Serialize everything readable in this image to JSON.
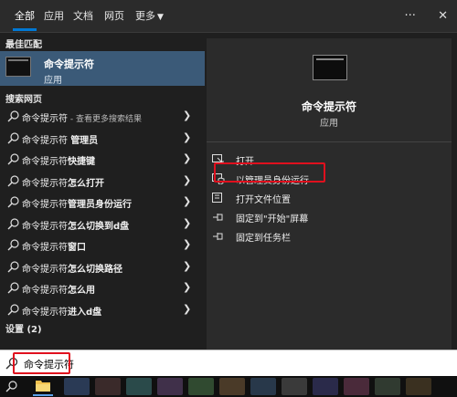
{
  "tabs": [
    {
      "label": "全部",
      "active": true
    },
    {
      "label": "应用"
    },
    {
      "label": "文档"
    },
    {
      "label": "网页"
    },
    {
      "label": "更多"
    }
  ],
  "top_icons": [
    "more-dots-icon",
    "close-icon"
  ],
  "left": {
    "best_match_label": "最佳匹配",
    "best_match": {
      "title": "命令提示符",
      "subtitle": "应用",
      "icon": "cmd-window-icon"
    },
    "web_search_label": "搜索网页",
    "web_results": [
      {
        "prefix": "命令提示符",
        "bold": "",
        "suffix": " - 查看更多搜索结果"
      },
      {
        "prefix": "命令提示符 ",
        "bold": "管理员",
        "suffix": ""
      },
      {
        "prefix": "命令提示符",
        "bold": "快捷键",
        "suffix": ""
      },
      {
        "prefix": "命令提示符",
        "bold": "怎么打开",
        "suffix": ""
      },
      {
        "prefix": "命令提示符",
        "bold": "管理员身份运行",
        "suffix": ""
      },
      {
        "prefix": "命令提示符",
        "bold": "怎么切换到d盘",
        "suffix": ""
      },
      {
        "prefix": "命令提示符",
        "bold": "窗口",
        "suffix": ""
      },
      {
        "prefix": "命令提示符",
        "bold": "怎么切换路径",
        "suffix": ""
      },
      {
        "prefix": "命令提示符",
        "bold": "怎么用",
        "suffix": ""
      },
      {
        "prefix": "命令提示符",
        "bold": "进入d盘",
        "suffix": ""
      }
    ],
    "settings_label": "设置 (2)"
  },
  "right": {
    "title": "命令提示符",
    "subtitle": "应用",
    "actions": [
      {
        "label": "打开",
        "icon": "open-icon"
      },
      {
        "label": "以管理员身份运行",
        "icon": "run-as-admin-icon",
        "highlighted": true
      },
      {
        "label": "打开文件位置",
        "icon": "file-location-icon"
      },
      {
        "label": "固定到\"开始\"屏幕",
        "icon": "pin-start-icon"
      },
      {
        "label": "固定到任务栏",
        "icon": "pin-taskbar-icon"
      }
    ]
  },
  "search": {
    "value": "命令提示符",
    "highlighted": true
  },
  "colors": {
    "accent": "#0078d4",
    "selected": "#3b5a78",
    "highlight_box": "#e0101e"
  }
}
